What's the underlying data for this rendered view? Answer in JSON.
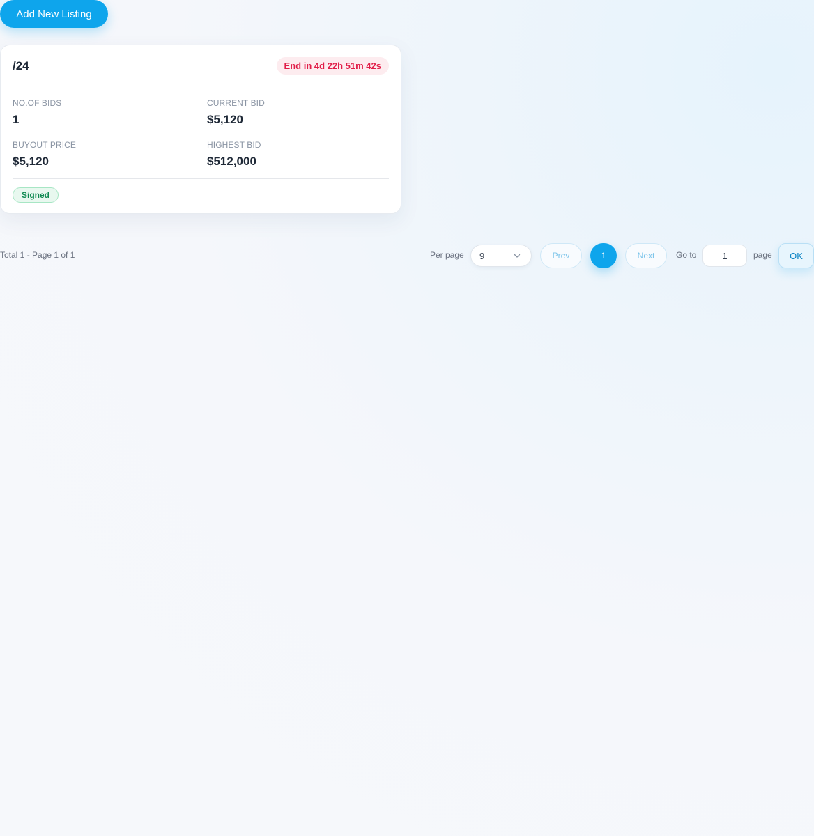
{
  "toolbar": {
    "add_label": "Add New Listing"
  },
  "listing": {
    "title": "/24",
    "countdown": "End in 4d 22h 51m 42s",
    "stats": {
      "bids_label": "NO.OF BIDS",
      "bids_value": "1",
      "current_bid_label": "CURRENT BID",
      "current_bid_value": "$5,120",
      "buyout_label": "BUYOUT PRICE",
      "buyout_value": "$5,120",
      "highest_bid_label": "HIGHEST BID",
      "highest_bid_value": "$512,000"
    },
    "status": "Signed"
  },
  "pagination": {
    "total_text": "Total 1 - Page 1 of 1",
    "per_page_label": "Per page",
    "per_page_value": "9",
    "prev_label": "Prev",
    "current_page": "1",
    "next_label": "Next",
    "goto_label": "Go to",
    "goto_value": "1",
    "page_label": "page",
    "ok_label": "OK"
  },
  "colors": {
    "accent": "#0ea5ec",
    "countdown_bg": "#fdecef",
    "countdown_text": "#e11d48",
    "status_bg": "#e8f8ef",
    "status_text": "#0f8a52"
  },
  "icons": {
    "per_page_dropdown": "chevron-down-icon"
  }
}
